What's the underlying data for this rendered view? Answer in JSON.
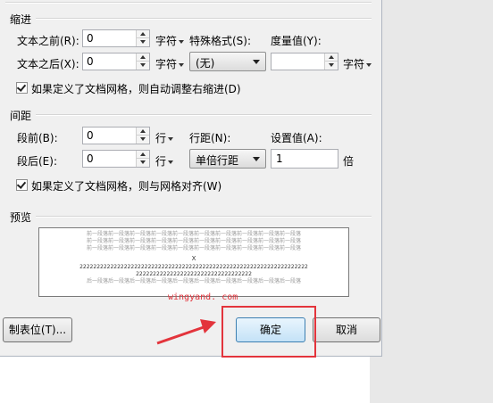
{
  "indent": {
    "title": "缩进",
    "before_label": "文本之前(R):",
    "before_value": "0",
    "before_unit": "字符",
    "after_label": "文本之后(X):",
    "after_value": "0",
    "after_unit": "字符",
    "special_label": "特殊格式(S):",
    "special_value": "(无)",
    "measure_label": "度量值(Y):",
    "measure_value": "",
    "measure_unit": "字符",
    "auto_adjust_label": "如果定义了文档网格，则自动调整右缩进(D)",
    "auto_adjust_checked": true
  },
  "spacing": {
    "title": "间距",
    "before_label": "段前(B):",
    "before_value": "0",
    "before_unit": "行",
    "after_label": "段后(E):",
    "after_value": "0",
    "after_unit": "行",
    "line_spacing_label": "行距(N):",
    "line_spacing_value": "单倍行距",
    "setting_label": "设置值(A):",
    "setting_value": "1",
    "setting_unit": "倍",
    "snap_grid_label": "如果定义了文档网格，则与网格对齐(W)",
    "snap_grid_checked": true
  },
  "preview": {
    "title": "预览",
    "prev_line": "前一段落前一段落前一段落前一段落前一段落前一段落前一段落前一段落前一段落前一段落",
    "marker": "X",
    "current_line1": "2222222222222222222222222222222222222222222222222222222222222222222",
    "current_line2": "2222222222222222222222222222222222",
    "next_line": "后一段落后一段落后一段落后一段落后一段落后一段落后一段落后一段落后一段落后一段落"
  },
  "watermark": "wingyand. com",
  "buttons": {
    "tabs": "制表位(T)...",
    "ok": "确定",
    "cancel": "取消"
  },
  "colors": {
    "highlight": "#e3343c",
    "dialog_bg": "#f0f0f0"
  }
}
